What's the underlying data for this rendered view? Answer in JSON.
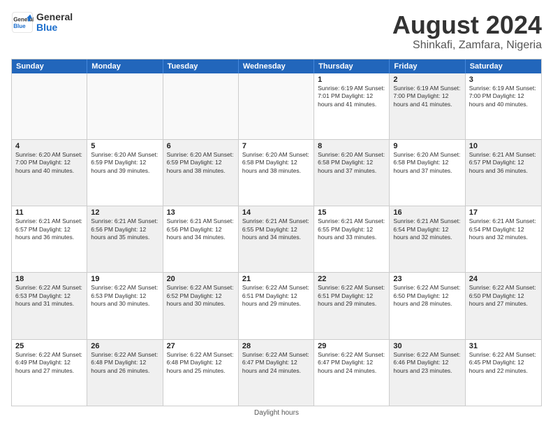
{
  "logo": {
    "line1": "General",
    "line2": "Blue"
  },
  "title": "August 2024",
  "subtitle": "Shinkafi, Zamfara, Nigeria",
  "days_of_week": [
    "Sunday",
    "Monday",
    "Tuesday",
    "Wednesday",
    "Thursday",
    "Friday",
    "Saturday"
  ],
  "footer": "Daylight hours",
  "weeks": [
    [
      {
        "day": "",
        "info": "",
        "shaded": false,
        "empty": true
      },
      {
        "day": "",
        "info": "",
        "shaded": false,
        "empty": true
      },
      {
        "day": "",
        "info": "",
        "shaded": false,
        "empty": true
      },
      {
        "day": "",
        "info": "",
        "shaded": false,
        "empty": true
      },
      {
        "day": "1",
        "info": "Sunrise: 6:19 AM\nSunset: 7:01 PM\nDaylight: 12 hours\nand 41 minutes.",
        "shaded": false,
        "empty": false
      },
      {
        "day": "2",
        "info": "Sunrise: 6:19 AM\nSunset: 7:00 PM\nDaylight: 12 hours\nand 41 minutes.",
        "shaded": true,
        "empty": false
      },
      {
        "day": "3",
        "info": "Sunrise: 6:19 AM\nSunset: 7:00 PM\nDaylight: 12 hours\nand 40 minutes.",
        "shaded": false,
        "empty": false
      }
    ],
    [
      {
        "day": "4",
        "info": "Sunrise: 6:20 AM\nSunset: 7:00 PM\nDaylight: 12 hours\nand 40 minutes.",
        "shaded": true,
        "empty": false
      },
      {
        "day": "5",
        "info": "Sunrise: 6:20 AM\nSunset: 6:59 PM\nDaylight: 12 hours\nand 39 minutes.",
        "shaded": false,
        "empty": false
      },
      {
        "day": "6",
        "info": "Sunrise: 6:20 AM\nSunset: 6:59 PM\nDaylight: 12 hours\nand 38 minutes.",
        "shaded": true,
        "empty": false
      },
      {
        "day": "7",
        "info": "Sunrise: 6:20 AM\nSunset: 6:58 PM\nDaylight: 12 hours\nand 38 minutes.",
        "shaded": false,
        "empty": false
      },
      {
        "day": "8",
        "info": "Sunrise: 6:20 AM\nSunset: 6:58 PM\nDaylight: 12 hours\nand 37 minutes.",
        "shaded": true,
        "empty": false
      },
      {
        "day": "9",
        "info": "Sunrise: 6:20 AM\nSunset: 6:58 PM\nDaylight: 12 hours\nand 37 minutes.",
        "shaded": false,
        "empty": false
      },
      {
        "day": "10",
        "info": "Sunrise: 6:21 AM\nSunset: 6:57 PM\nDaylight: 12 hours\nand 36 minutes.",
        "shaded": true,
        "empty": false
      }
    ],
    [
      {
        "day": "11",
        "info": "Sunrise: 6:21 AM\nSunset: 6:57 PM\nDaylight: 12 hours\nand 36 minutes.",
        "shaded": false,
        "empty": false
      },
      {
        "day": "12",
        "info": "Sunrise: 6:21 AM\nSunset: 6:56 PM\nDaylight: 12 hours\nand 35 minutes.",
        "shaded": true,
        "empty": false
      },
      {
        "day": "13",
        "info": "Sunrise: 6:21 AM\nSunset: 6:56 PM\nDaylight: 12 hours\nand 34 minutes.",
        "shaded": false,
        "empty": false
      },
      {
        "day": "14",
        "info": "Sunrise: 6:21 AM\nSunset: 6:55 PM\nDaylight: 12 hours\nand 34 minutes.",
        "shaded": true,
        "empty": false
      },
      {
        "day": "15",
        "info": "Sunrise: 6:21 AM\nSunset: 6:55 PM\nDaylight: 12 hours\nand 33 minutes.",
        "shaded": false,
        "empty": false
      },
      {
        "day": "16",
        "info": "Sunrise: 6:21 AM\nSunset: 6:54 PM\nDaylight: 12 hours\nand 32 minutes.",
        "shaded": true,
        "empty": false
      },
      {
        "day": "17",
        "info": "Sunrise: 6:21 AM\nSunset: 6:54 PM\nDaylight: 12 hours\nand 32 minutes.",
        "shaded": false,
        "empty": false
      }
    ],
    [
      {
        "day": "18",
        "info": "Sunrise: 6:22 AM\nSunset: 6:53 PM\nDaylight: 12 hours\nand 31 minutes.",
        "shaded": true,
        "empty": false
      },
      {
        "day": "19",
        "info": "Sunrise: 6:22 AM\nSunset: 6:53 PM\nDaylight: 12 hours\nand 30 minutes.",
        "shaded": false,
        "empty": false
      },
      {
        "day": "20",
        "info": "Sunrise: 6:22 AM\nSunset: 6:52 PM\nDaylight: 12 hours\nand 30 minutes.",
        "shaded": true,
        "empty": false
      },
      {
        "day": "21",
        "info": "Sunrise: 6:22 AM\nSunset: 6:51 PM\nDaylight: 12 hours\nand 29 minutes.",
        "shaded": false,
        "empty": false
      },
      {
        "day": "22",
        "info": "Sunrise: 6:22 AM\nSunset: 6:51 PM\nDaylight: 12 hours\nand 29 minutes.",
        "shaded": true,
        "empty": false
      },
      {
        "day": "23",
        "info": "Sunrise: 6:22 AM\nSunset: 6:50 PM\nDaylight: 12 hours\nand 28 minutes.",
        "shaded": false,
        "empty": false
      },
      {
        "day": "24",
        "info": "Sunrise: 6:22 AM\nSunset: 6:50 PM\nDaylight: 12 hours\nand 27 minutes.",
        "shaded": true,
        "empty": false
      }
    ],
    [
      {
        "day": "25",
        "info": "Sunrise: 6:22 AM\nSunset: 6:49 PM\nDaylight: 12 hours\nand 27 minutes.",
        "shaded": false,
        "empty": false
      },
      {
        "day": "26",
        "info": "Sunrise: 6:22 AM\nSunset: 6:48 PM\nDaylight: 12 hours\nand 26 minutes.",
        "shaded": true,
        "empty": false
      },
      {
        "day": "27",
        "info": "Sunrise: 6:22 AM\nSunset: 6:48 PM\nDaylight: 12 hours\nand 25 minutes.",
        "shaded": false,
        "empty": false
      },
      {
        "day": "28",
        "info": "Sunrise: 6:22 AM\nSunset: 6:47 PM\nDaylight: 12 hours\nand 24 minutes.",
        "shaded": true,
        "empty": false
      },
      {
        "day": "29",
        "info": "Sunrise: 6:22 AM\nSunset: 6:47 PM\nDaylight: 12 hours\nand 24 minutes.",
        "shaded": false,
        "empty": false
      },
      {
        "day": "30",
        "info": "Sunrise: 6:22 AM\nSunset: 6:46 PM\nDaylight: 12 hours\nand 23 minutes.",
        "shaded": true,
        "empty": false
      },
      {
        "day": "31",
        "info": "Sunrise: 6:22 AM\nSunset: 6:45 PM\nDaylight: 12 hours\nand 22 minutes.",
        "shaded": false,
        "empty": false
      }
    ]
  ]
}
